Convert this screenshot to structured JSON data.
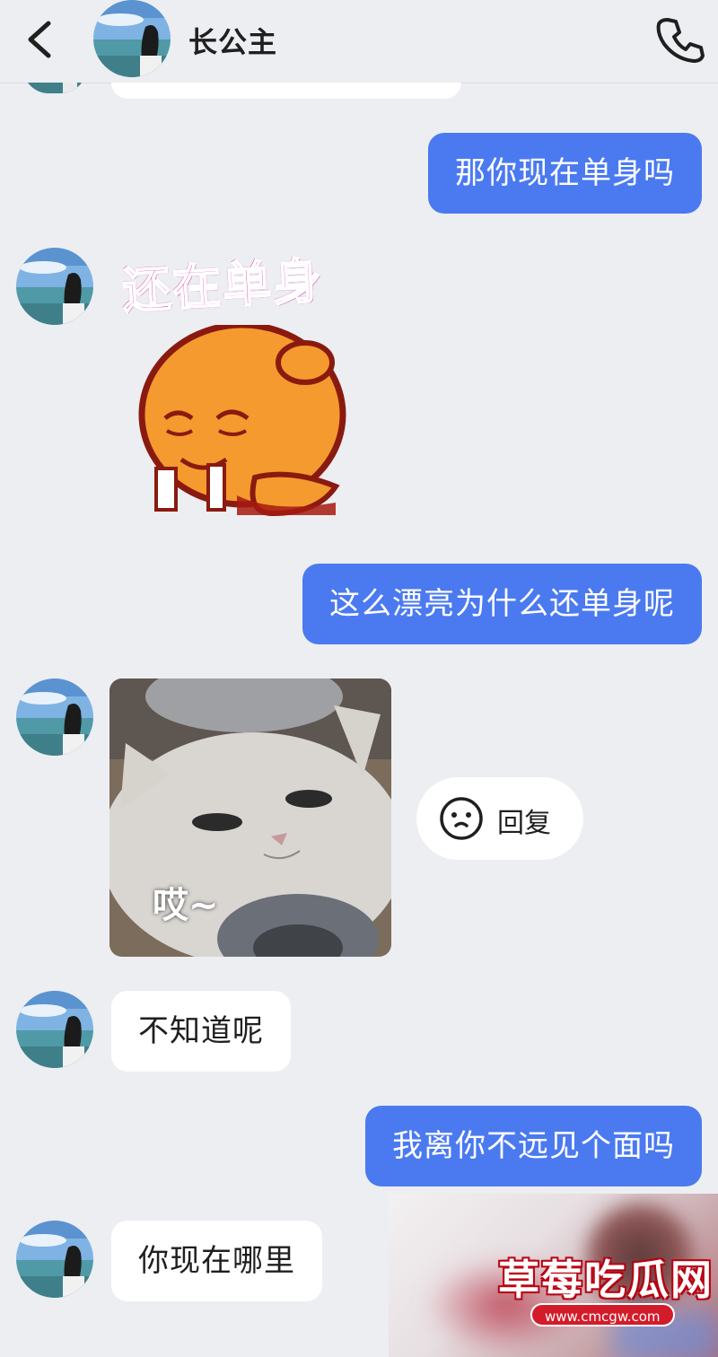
{
  "header": {
    "contact_name": "长公主",
    "back_icon": "chevron-left-icon",
    "call_icon": "phone-icon"
  },
  "messages": [
    {
      "side": "out",
      "type": "text",
      "text": "那你现在单身吗"
    },
    {
      "side": "in",
      "type": "sticker",
      "caption": "还在单身"
    },
    {
      "side": "out",
      "type": "text",
      "text": "这么漂亮为什么还单身呢"
    },
    {
      "side": "in",
      "type": "image",
      "caption": "哎~"
    },
    {
      "side": "in",
      "type": "text",
      "text": "不知道呢"
    },
    {
      "side": "out",
      "type": "text",
      "text": "我离你不远见个面吗"
    },
    {
      "side": "in",
      "type": "text",
      "text": "你现在哪里"
    }
  ],
  "reply_chip": {
    "label": "回复",
    "icon": "smiley-face-icon"
  },
  "watermark": {
    "title": "草莓吃瓜网",
    "url": "www.cmcgw.com"
  },
  "colors": {
    "background": "#eceef2",
    "outgoing_bubble": "#4b7af0",
    "incoming_bubble": "#ffffff",
    "sticker_text": "#e13aa6",
    "watermark_red": "#d31c2a"
  }
}
